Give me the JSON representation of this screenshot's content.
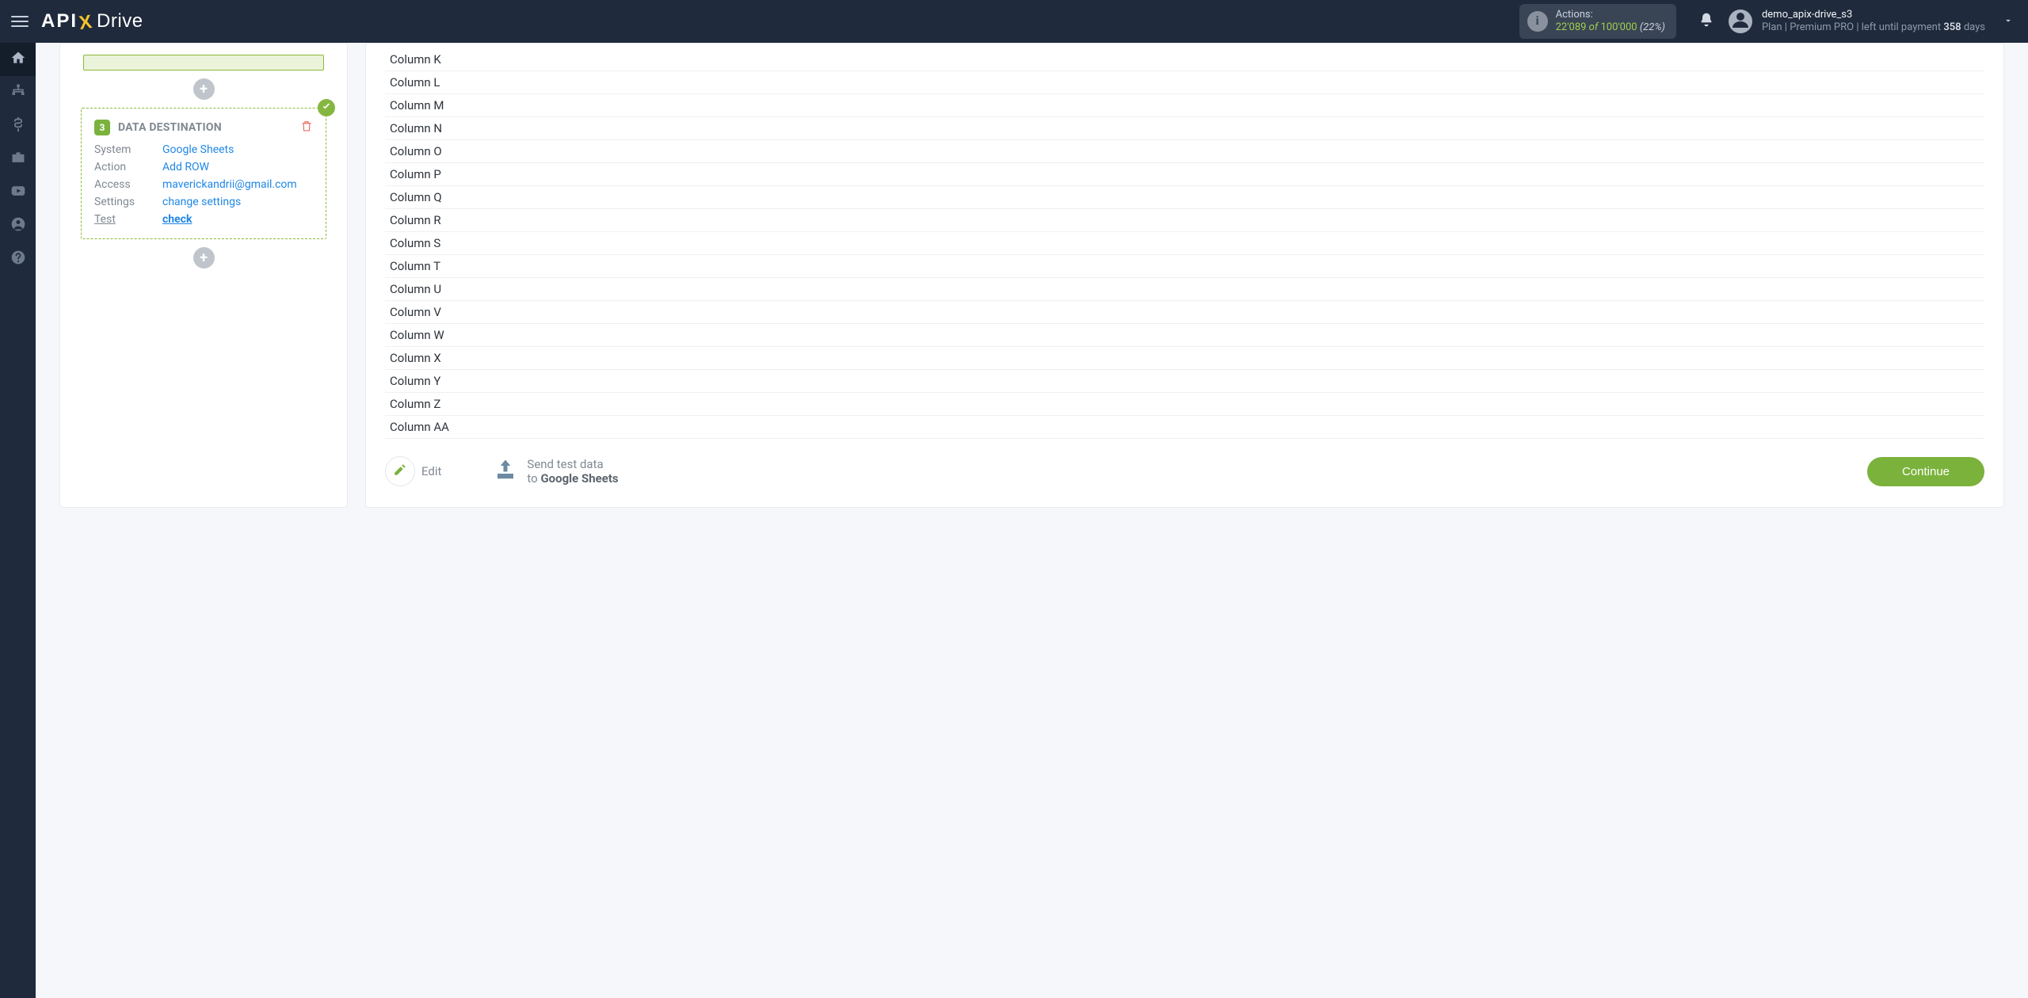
{
  "header": {
    "actions_label": "Actions:",
    "actions_used": "22'089",
    "actions_of": "of",
    "actions_total": "100'000",
    "actions_pct": "(22%)",
    "username": "demo_apix-drive_s3",
    "plan_prefix": "Plan |",
    "plan_name": "Premium PRO",
    "plan_mid": "| left until payment ",
    "plan_days": "358",
    "plan_suffix": " days"
  },
  "destination": {
    "step": "3",
    "title": "DATA DESTINATION",
    "rows": {
      "system_k": "System",
      "system_v": "Google Sheets",
      "action_k": "Action",
      "action_v": "Add ROW",
      "access_k": "Access",
      "access_v": "maverickandrii@gmail.com",
      "settings_k": "Settings",
      "settings_v": "change settings",
      "test_k": "Test",
      "test_v": "check"
    }
  },
  "columns": [
    "Column K",
    "Column L",
    "Column M",
    "Column N",
    "Column O",
    "Column P",
    "Column Q",
    "Column R",
    "Column S",
    "Column T",
    "Column U",
    "Column V",
    "Column W",
    "Column X",
    "Column Y",
    "Column Z",
    "Column AA"
  ],
  "footer": {
    "edit": "Edit",
    "send_l1": "Send test data",
    "send_l2_to": "to ",
    "send_l2_dest": "Google Sheets",
    "continue": "Continue"
  }
}
